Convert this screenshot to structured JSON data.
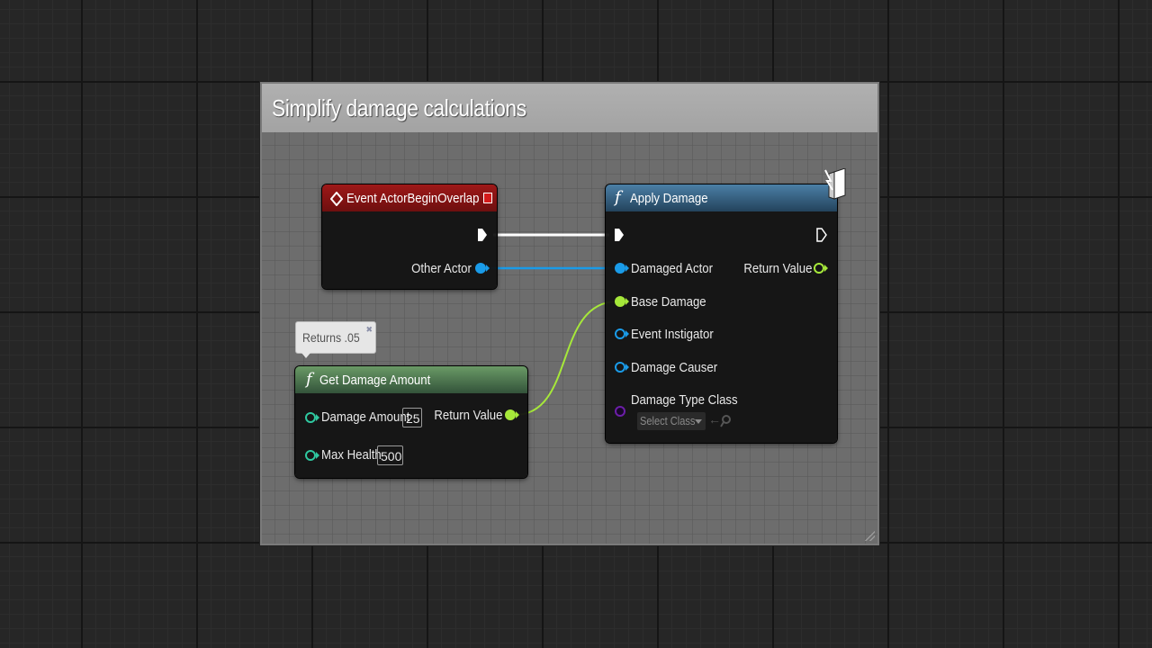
{
  "comment": {
    "title": "Simplify damage calculations"
  },
  "nodes": {
    "event_overlap": {
      "title": "Event ActorBeginOverlap",
      "pins": {
        "other_actor": "Other Actor"
      }
    },
    "apply_damage": {
      "title": "Apply Damage",
      "pins": {
        "damaged_actor": "Damaged Actor",
        "base_damage": "Base Damage",
        "event_instigator": "Event Instigator",
        "damage_causer": "Damage Causer",
        "damage_type_class": "Damage Type Class",
        "return_value": "Return Value"
      },
      "class_select": "Select Class"
    },
    "get_damage_amount": {
      "title": "Get Damage Amount",
      "tooltip": "Returns .05",
      "pins": {
        "damage_amount": "Damage Amount",
        "damage_amount_value": "25",
        "max_health": "Max Health",
        "max_health_value": "500",
        "return_value": "Return Value"
      }
    }
  },
  "colors": {
    "event_header": "#8a1414",
    "function_header_blue": "#3b6b8e",
    "function_header_green": "#4d7a4a",
    "object_pin": "#1a9be8",
    "float_pin": "#a6e83a",
    "int_pin": "#2fc8a0",
    "class_pin": "#6c1ea8"
  }
}
